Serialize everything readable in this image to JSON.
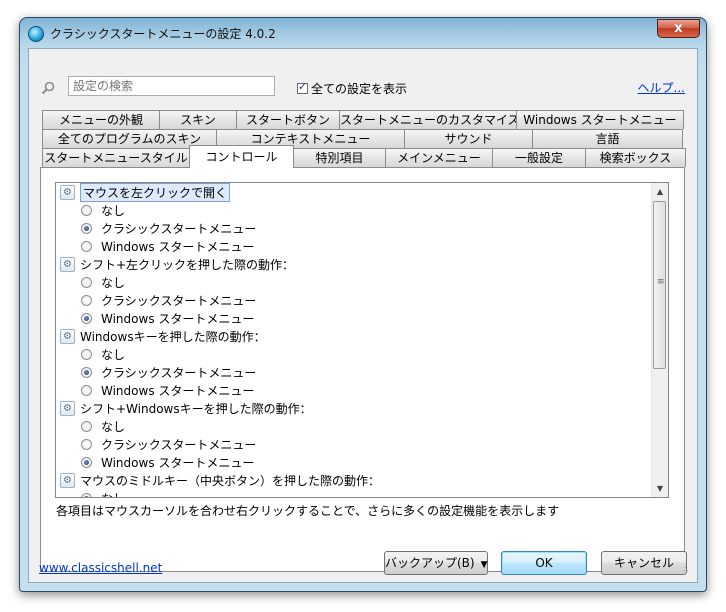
{
  "window": {
    "title": "クラシックスタートメニューの設定 4.0.2",
    "close_label": "x"
  },
  "search": {
    "placeholder": "設定の検索",
    "value": ""
  },
  "show_all": {
    "label": "全ての設定を表示",
    "checked": true
  },
  "help_label": "ヘルプ...",
  "tabs": {
    "row1": [
      "メニューの外観",
      "スキン",
      "スタートボタン",
      "スタートメニューのカスタマイズ",
      "Windows スタートメニュー"
    ],
    "row2": [
      "全てのプログラムのスキン",
      "コンテキストメニュー",
      "サウンド",
      "言語"
    ],
    "row3": [
      "スタートメニュースタイル",
      "コントロール",
      "特別項目",
      "メインメニュー",
      "一般設定",
      "検索ボックス"
    ],
    "active": "コントロール"
  },
  "groups": [
    {
      "label": "マウスを左クリックで開く",
      "selected": true,
      "options": [
        "なし",
        "クラシックスタートメニュー",
        "Windows スタートメニュー"
      ],
      "checked_index": 1
    },
    {
      "label": "シフト+左クリックを押した際の動作：",
      "options": [
        "なし",
        "クラシックスタートメニュー",
        "Windows スタートメニュー"
      ],
      "checked_index": 2
    },
    {
      "label": "Windowsキーを押した際の動作：",
      "options": [
        "なし",
        "クラシックスタートメニュー",
        "Windows スタートメニュー"
      ],
      "checked_index": 1
    },
    {
      "label": "シフト+Windowsキーを押した際の動作：",
      "options": [
        "なし",
        "クラシックスタートメニュー",
        "Windows スタートメニュー"
      ],
      "checked_index": 2
    },
    {
      "label": "マウスのミドルキー（中央ボタン）を押した際の動作：",
      "options": [
        "なし"
      ],
      "checked_index": 0
    }
  ],
  "hint": "各項目はマウスカーソルを合わせ右クリックすることで、さらに多くの設定機能を表示します",
  "footer": {
    "link": "www.classicshell.net",
    "backup_label": "バックアップ(B)",
    "ok_label": "OK",
    "cancel_label": "キャンセル"
  }
}
